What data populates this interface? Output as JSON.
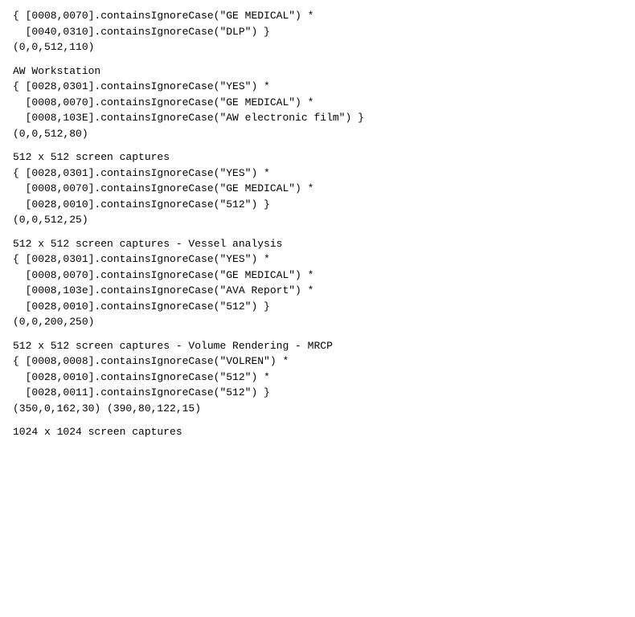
{
  "content": {
    "sections": [
      {
        "id": "section-top",
        "title": null,
        "lines": [
          "{ [0008,0070].containsIgnoreCase(\"GE MEDICAL\") *",
          "  [0040,0310].containsIgnoreCase(\"DLP\") }",
          "(0,0,512,110)"
        ]
      },
      {
        "id": "section-aw-workstation",
        "title": "AW Workstation",
        "lines": [
          "{ [0028,0301].containsIgnoreCase(\"YES\") *",
          "  [0008,0070].containsIgnoreCase(\"GE MEDICAL\") *",
          "  [0008,103E].containsIgnoreCase(\"AW electronic film\") }",
          "(0,0,512,80)"
        ]
      },
      {
        "id": "section-512-captures",
        "title": "512 x 512 screen captures",
        "lines": [
          "{ [0028,0301].containsIgnoreCase(\"YES\") *",
          "  [0008,0070].containsIgnoreCase(\"GE MEDICAL\") *",
          "  [0028,0010].containsIgnoreCase(\"512\") }",
          "(0,0,512,25)"
        ]
      },
      {
        "id": "section-512-vessel",
        "title": "512 x 512 screen captures - Vessel analysis",
        "lines": [
          "{ [0028,0301].containsIgnoreCase(\"YES\") *",
          "  [0008,0070].containsIgnoreCase(\"GE MEDICAL\") *",
          "  [0008,103e].containsIgnoreCase(\"AVA Report\") *",
          "  [0028,0010].containsIgnoreCase(\"512\") }",
          "(0,0,200,250)"
        ]
      },
      {
        "id": "section-512-volume",
        "title": "512 x 512 screen captures - Volume Rendering - MRCP",
        "lines": [
          "{ [0008,0008].containsIgnoreCase(\"VOLREN\") *",
          "  [0028,0010].containsIgnoreCase(\"512\") *",
          "  [0028,0011].containsIgnoreCase(\"512\") }",
          "(350,0,162,30) (390,80,122,15)"
        ]
      },
      {
        "id": "section-1024-title",
        "title": "1024 x 1024 screen captures",
        "lines": []
      }
    ]
  }
}
